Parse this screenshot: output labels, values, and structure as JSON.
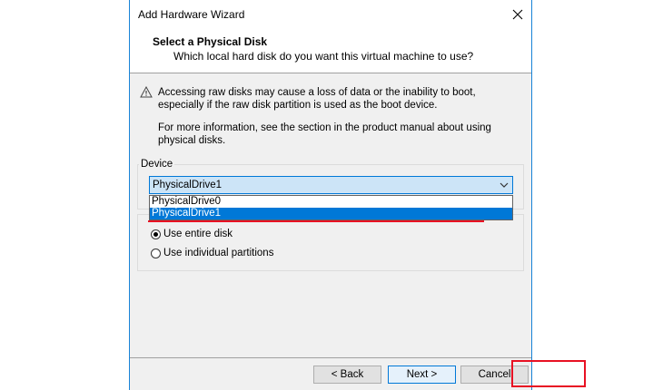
{
  "window": {
    "title": "Add Hardware Wizard",
    "close_icon": "close-icon"
  },
  "header": {
    "title": "Select a Physical Disk",
    "subtitle": "Which local hard disk do you want this virtual machine to use?"
  },
  "body": {
    "warning_icon": "warning-icon",
    "warning_text": "Accessing raw disks may cause a loss of data or the inability to boot, especially if the raw disk partition is used as the boot device.",
    "info_text": "For more information, see the section in the product manual about using physical disks."
  },
  "device": {
    "label": "Device",
    "selected": "PhysicalDrive1",
    "options": [
      "PhysicalDrive0",
      "PhysicalDrive1"
    ]
  },
  "usage": {
    "options": [
      {
        "label": "Use entire disk",
        "checked": true
      },
      {
        "label": "Use individual partitions",
        "checked": false
      }
    ]
  },
  "footer": {
    "back_label": "< Back",
    "next_label": "Next >",
    "cancel_label": "Cancel"
  },
  "colors": {
    "accent": "#0078d7",
    "highlight_red": "#e81123",
    "window_border": "#1883d7"
  }
}
